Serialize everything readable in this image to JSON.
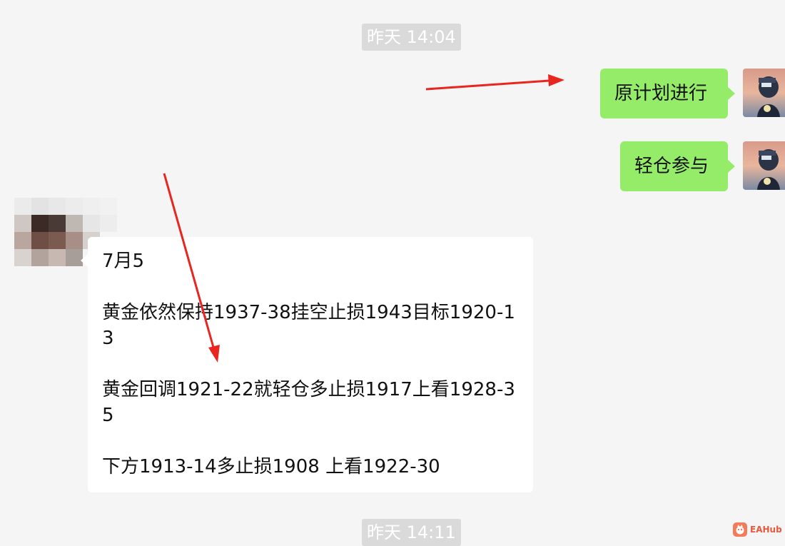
{
  "chat": {
    "timestamps": [
      "昨天 14:04",
      "昨天 14:11"
    ],
    "outgoing": [
      {
        "text": "原计划进行"
      },
      {
        "text": "轻仓参与"
      }
    ],
    "incoming": {
      "lines": [
        "7月5",
        "黄金依然保持1937-38挂空止损1943目标1920-13",
        "黄金回调1921-22就轻仓多止损1917上看1928-35",
        "下方1913-14多止损1908 上看1922-30"
      ]
    }
  },
  "watermark": {
    "text": "EAHub",
    "color": "#e85a3e"
  },
  "colors": {
    "background": "#f5f5f5",
    "outgoing_bubble": "#95ec69",
    "incoming_bubble": "#ffffff",
    "arrow": "#e8251f"
  }
}
